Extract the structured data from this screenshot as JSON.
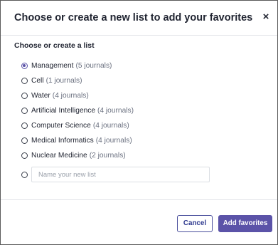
{
  "dialog": {
    "title": "Choose or create a new list to add your favorites",
    "close_label": "×",
    "section_label": "Choose or create a list"
  },
  "lists": [
    {
      "name": "Management",
      "count": "(5 journals)",
      "selected": true
    },
    {
      "name": "Cell",
      "count": "(1 journals)",
      "selected": false
    },
    {
      "name": "Water",
      "count": "(4 journals)",
      "selected": false
    },
    {
      "name": "Artificial Intelligence",
      "count": "(4 journals)",
      "selected": false
    },
    {
      "name": "Computer Science",
      "count": "(4 journals)",
      "selected": false
    },
    {
      "name": "Medical Informatics",
      "count": "(4 journals)",
      "selected": false
    },
    {
      "name": "Nuclear Medicine",
      "count": "(2 journals)",
      "selected": false
    }
  ],
  "new_list": {
    "placeholder": "Name your new list",
    "value": ""
  },
  "footer": {
    "cancel_label": "Cancel",
    "add_label": "Add favorites"
  },
  "colors": {
    "accent": "#5b53a8",
    "cancel_text": "#2f3a8f"
  }
}
